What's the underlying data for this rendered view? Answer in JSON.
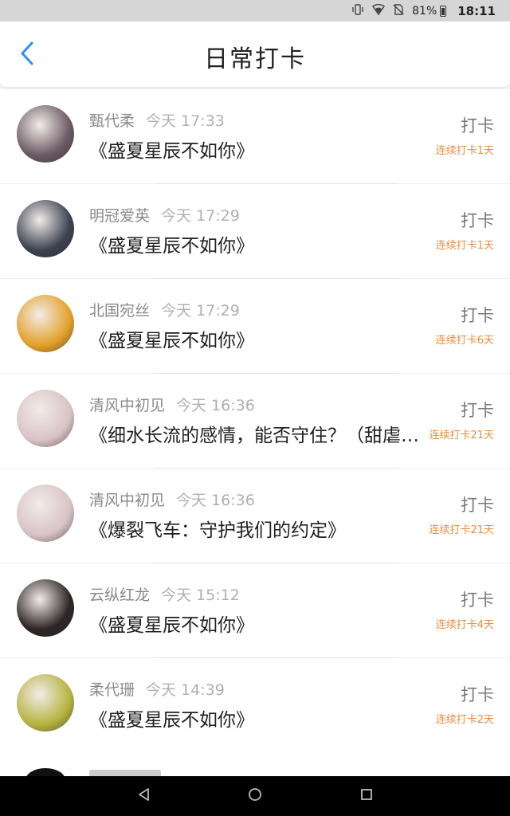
{
  "status_bar": {
    "battery": "81%",
    "time": "18:11",
    "icons": [
      "vibrate-icon",
      "wifi-icon",
      "no-sim-icon",
      "battery-icon"
    ]
  },
  "header": {
    "title": "日常打卡",
    "back_icon": "chevron-left-icon"
  },
  "items": [
    {
      "name": "甄代柔",
      "time": "今天 17:33",
      "title": "《盛夏星辰不如你》",
      "action": "打卡",
      "streak": "连续打卡1天",
      "avatar_color": "#6b5a63"
    },
    {
      "name": "明冠爱英",
      "time": "今天 17:29",
      "title": "《盛夏星辰不如你》",
      "action": "打卡",
      "streak": "连续打卡1天",
      "avatar_color": "#3c4250"
    },
    {
      "name": "北国宛丝",
      "time": "今天 17:29",
      "title": "《盛夏星辰不如你》",
      "action": "打卡",
      "streak": "连续打卡6天",
      "avatar_color": "#e3a12a"
    },
    {
      "name": "清风中初见",
      "time": "今天 16:36",
      "title": "《细水长流的感情，能否守住？（甜虐…",
      "action": "打卡",
      "streak": "连续打卡21天",
      "avatar_color": "#d9c3c6"
    },
    {
      "name": "清风中初见",
      "time": "今天 16:36",
      "title": "《爆裂飞车：守护我们的约定》",
      "action": "打卡",
      "streak": "连续打卡21天",
      "avatar_color": "#d9c3c6"
    },
    {
      "name": "云纵红龙",
      "time": "今天 15:12",
      "title": "《盛夏星辰不如你》",
      "action": "打卡",
      "streak": "连续打卡4天",
      "avatar_color": "#2e2626"
    },
    {
      "name": "柔代珊",
      "time": "今天 14:39",
      "title": "《盛夏星辰不如你》",
      "action": "打卡",
      "streak": "连续打卡2天",
      "avatar_color": "#b7b341"
    }
  ],
  "nav": {
    "icons": [
      "back-triangle-icon",
      "home-circle-icon",
      "recents-square-icon"
    ]
  }
}
